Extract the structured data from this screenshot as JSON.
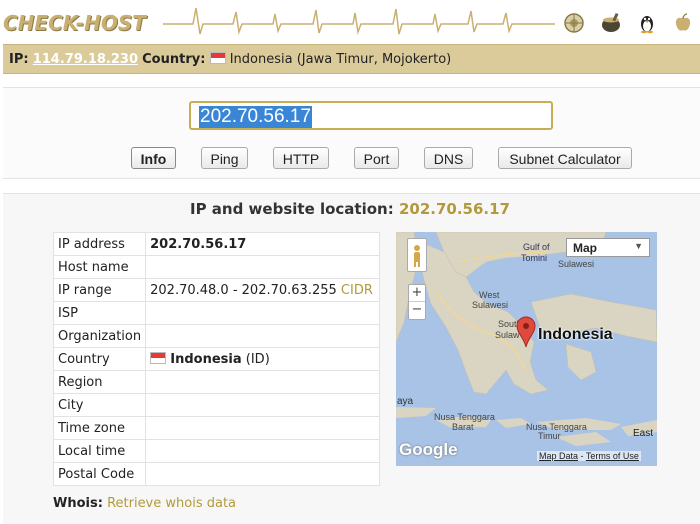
{
  "header": {
    "logo": "CHECK-HOST",
    "icons": [
      "globe-icon",
      "cauldron-icon",
      "linux-penguin-icon",
      "apple-icon"
    ]
  },
  "ipbar": {
    "ip_label": "IP:",
    "ip_value": "114.79.18.230",
    "country_label": "Country:",
    "country_value": "Indonesia (Jawa Timur, Mojokerto)"
  },
  "search": {
    "host_value": "202.70.56.17"
  },
  "tabs": [
    {
      "label": "Info",
      "active": true
    },
    {
      "label": "Ping",
      "active": false
    },
    {
      "label": "HTTP",
      "active": false
    },
    {
      "label": "Port",
      "active": false
    },
    {
      "label": "DNS",
      "active": false
    },
    {
      "label": "Subnet Calculator",
      "active": false
    }
  ],
  "result": {
    "title": "IP and website location:",
    "host": "202.70.56.17",
    "rows": {
      "ip_address": {
        "key": "IP address",
        "value": "202.70.56.17"
      },
      "host_name": {
        "key": "Host name",
        "value": ""
      },
      "ip_range": {
        "key": "IP range",
        "value": "202.70.48.0 - 202.70.63.255",
        "link": "CIDR"
      },
      "isp": {
        "key": "ISP",
        "value": ""
      },
      "organization": {
        "key": "Organization",
        "value": ""
      },
      "country": {
        "key": "Country",
        "value": "Indonesia",
        "code": "(ID)"
      },
      "region": {
        "key": "Region",
        "value": ""
      },
      "city": {
        "key": "City",
        "value": ""
      },
      "time_zone": {
        "key": "Time zone",
        "value": ""
      },
      "local_time": {
        "key": "Local time",
        "value": ""
      },
      "postal_code": {
        "key": "Postal Code",
        "value": ""
      }
    },
    "whois_label": "Whois:",
    "whois_link": "Retrieve whois data"
  },
  "map": {
    "type_select": "Map",
    "marker_label": "Indonesia",
    "labels": {
      "gulf1": "Gulf of",
      "gulf2": "Tomini",
      "sulawesi": "Sulawesi",
      "west1": "West",
      "west2": "Sulawesi",
      "south1": "South",
      "south2": "Sulaw",
      "aya": "aya",
      "nt1": "Nusa Tenggara",
      "nt2": "Barat",
      "nt3": "Nusa Tenggara",
      "nt4": "Timur",
      "east": "East"
    },
    "zoom_in": "+",
    "zoom_out": "−",
    "provider": "Google",
    "map_data": "Map Data",
    "separator": " - ",
    "terms": "Terms of Use"
  },
  "colors": {
    "accent_gold": "#b29a3c",
    "ipbar_bg": "#dccb9a",
    "input_border": "#c9ad54",
    "selection": "#3a86d6"
  }
}
